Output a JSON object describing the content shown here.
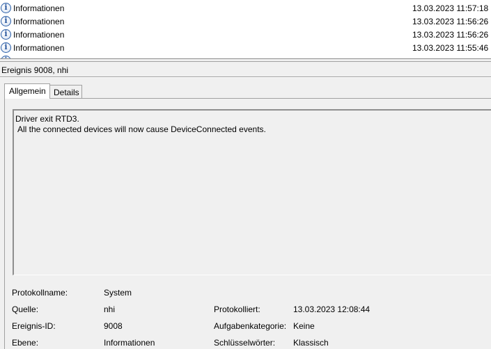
{
  "event_list": {
    "rows": [
      {
        "level": "Informationen",
        "date": "13.03.2023 11:57:18"
      },
      {
        "level": "Informationen",
        "date": "13.03.2023 11:56:26"
      },
      {
        "level": "Informationen",
        "date": "13.03.2023 11:56:26"
      },
      {
        "level": "Informationen",
        "date": "13.03.2023 11:55:46"
      }
    ],
    "icon": "information-icon"
  },
  "detail": {
    "title": "Ereignis 9008, nhi",
    "tabs": [
      {
        "label": "Allgemein",
        "selected": true
      },
      {
        "label": "Details",
        "selected": false
      }
    ],
    "description": {
      "line1": "Driver exit RTD3.",
      "line2": "All the connected devices will now cause DeviceConnected events."
    },
    "properties": {
      "log_name_label": "Protokollname:",
      "log_name_value": "System",
      "source_label": "Quelle:",
      "source_value": "nhi",
      "logged_label": "Protokolliert:",
      "logged_value": "13.03.2023 12:08:44",
      "event_id_label": "Ereignis-ID:",
      "event_id_value": "9008",
      "task_category_label": "Aufgabenkategorie:",
      "task_category_value": "Keine",
      "level_label": "Ebene:",
      "level_value": "Informationen",
      "keywords_label": "Schlüsselwörter:",
      "keywords_value": "Klassisch"
    }
  }
}
